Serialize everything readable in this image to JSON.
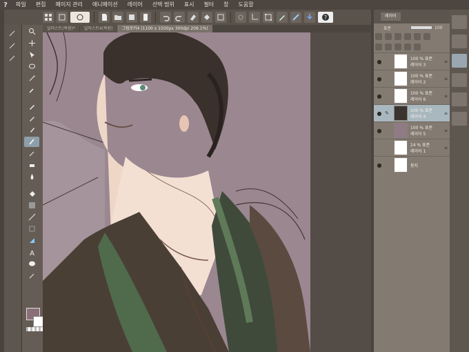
{
  "menu": [
    "파일",
    "편집",
    "페이지 관리",
    "애니메이션",
    "레이어",
    "선택 범위",
    "표시",
    "필터",
    "창",
    "도움말"
  ],
  "document_tabs": [
    {
      "label": "일러스트(복원)*"
    },
    {
      "label": "일러스트4(복원)"
    },
    {
      "label": "그림로키4 (1100 x 1500px 300dpi 209.1%)"
    }
  ],
  "layer_panel": {
    "tab_label": "레이어",
    "blend_mode": "표준",
    "opacity_value": "100",
    "layers": [
      {
        "line1": "100 % 표준",
        "line2": "레이어 3",
        "thumb_color": "#ffffff",
        "selected": false,
        "visible": true
      },
      {
        "line1": "100 % 표준",
        "line2": "레이어 2",
        "thumb_color": "#ffffff",
        "selected": false,
        "visible": true
      },
      {
        "line1": "100 % 표준",
        "line2": "레이어 6",
        "thumb_color": "#ffffff",
        "selected": false,
        "visible": true
      },
      {
        "line1": "100 % 표준",
        "line2": "레이어 4",
        "thumb_color": "#3a3330",
        "selected": true,
        "visible": true
      },
      {
        "line1": "100 % 표준",
        "line2": "레이어 5",
        "thumb_color": "#8f7a86",
        "selected": false,
        "visible": true
      },
      {
        "line1": "24 % 표준",
        "line2": "레이어 1",
        "thumb_color": "#ffffff",
        "selected": false,
        "visible": false
      },
      {
        "line1": "",
        "line2": "용지",
        "thumb_color": "#ffffff",
        "selected": false,
        "visible": true
      }
    ]
  },
  "colors": {
    "main_color": "#8a6f78",
    "sub_color": "#ffffff",
    "canvas_background": "#9a8790"
  }
}
